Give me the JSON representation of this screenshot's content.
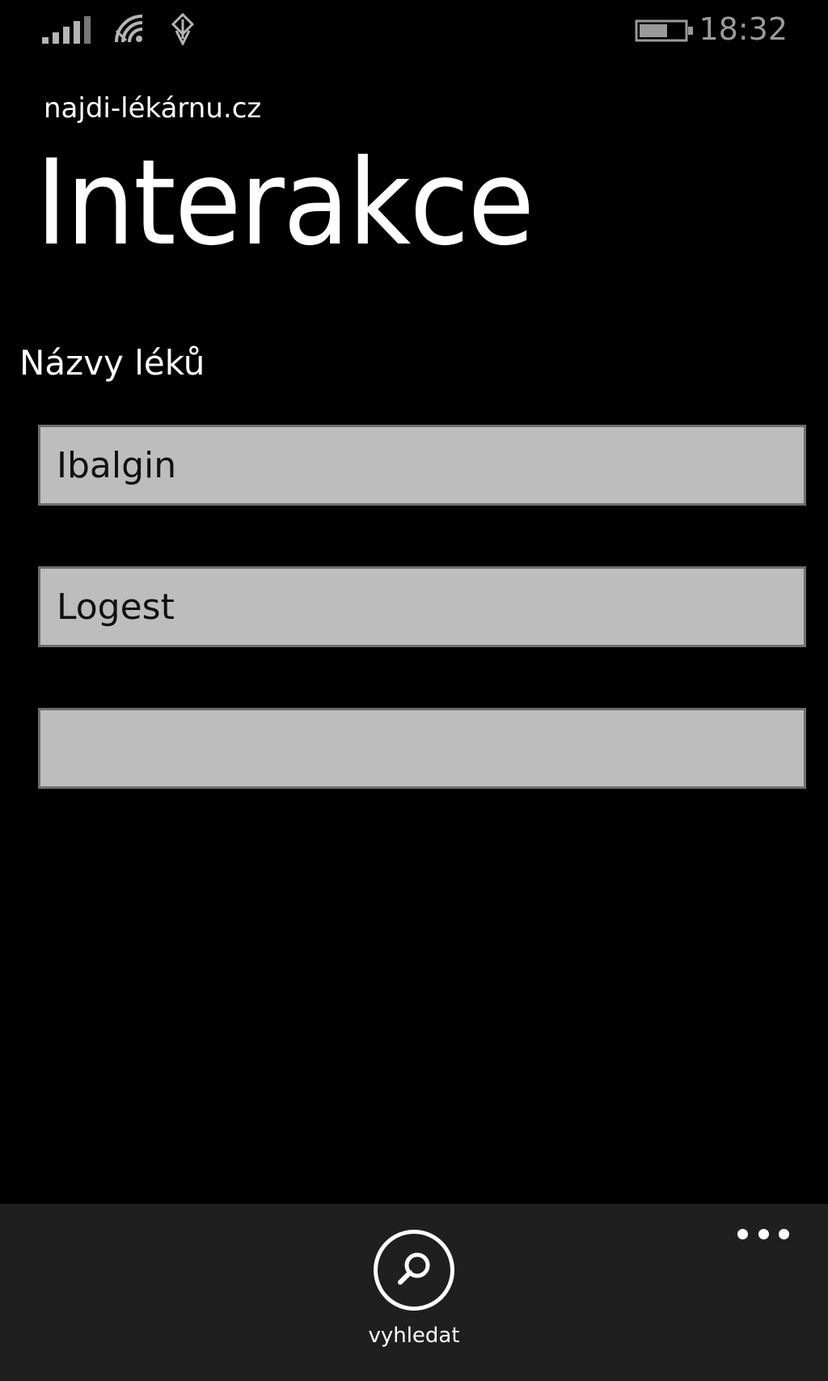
{
  "status_bar": {
    "time": "18:32",
    "icons": [
      "signal-icon",
      "wifi-icon",
      "data-sync-icon",
      "battery-icon"
    ]
  },
  "header": {
    "app_name": "najdi-lékárnu.cz",
    "title": "Interakce"
  },
  "form": {
    "section_label": "Názvy léků",
    "fields": [
      {
        "value": "Ibalgin",
        "placeholder": ""
      },
      {
        "value": "Logest",
        "placeholder": ""
      },
      {
        "value": "",
        "placeholder": ""
      }
    ]
  },
  "app_bar": {
    "search_label": "vyhledat",
    "search_icon": "search-icon",
    "more_icon": "more-icon"
  },
  "colors": {
    "background": "#000000",
    "field_background": "#bdbdbd",
    "app_bar_background": "#1f1f1f",
    "text": "#ffffff"
  }
}
